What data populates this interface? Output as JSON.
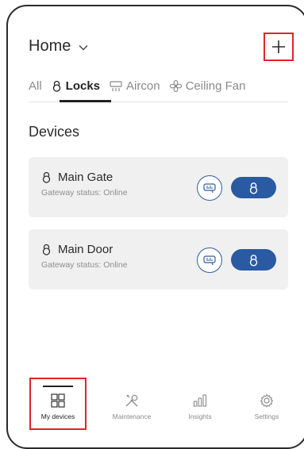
{
  "header": {
    "title": "Home"
  },
  "tabs": [
    {
      "label": "All",
      "icon": "none"
    },
    {
      "label": "Locks",
      "icon": "lock-icon"
    },
    {
      "label": "Aircon",
      "icon": "aircon-icon"
    },
    {
      "label": "Ceiling Fan",
      "icon": "fan-icon"
    }
  ],
  "section": {
    "title": "Devices"
  },
  "devices": [
    {
      "name": "Main Gate",
      "status": "Gateway status: Online"
    },
    {
      "name": "Main Door",
      "status": "Gateway status: Online"
    }
  ],
  "bottom_nav": [
    {
      "label": "My devices",
      "icon": "grid-icon"
    },
    {
      "label": "Maintenance",
      "icon": "tools-icon"
    },
    {
      "label": "Insights",
      "icon": "bars-icon"
    },
    {
      "label": "Settings",
      "icon": "gear-icon"
    }
  ],
  "colors": {
    "accent": "#2a5aa2",
    "highlight": "#e0232b",
    "card_bg": "#f0f0f1"
  }
}
